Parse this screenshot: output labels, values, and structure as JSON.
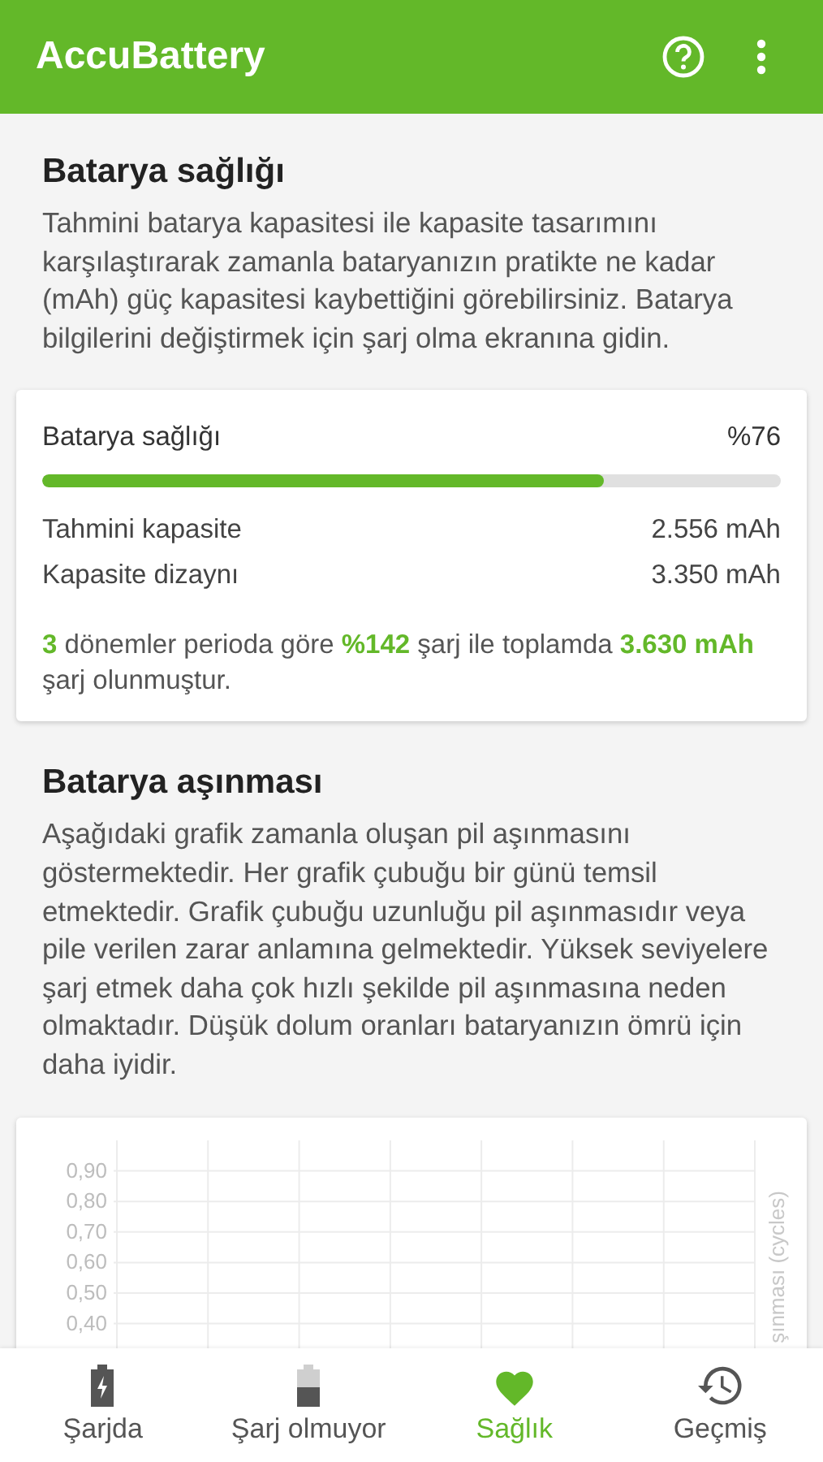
{
  "app_bar": {
    "title": "AccuBattery"
  },
  "health": {
    "title": "Batarya sağlığı",
    "description": "Tahmini batarya kapasitesi ile kapasite tasarımını karşılaştırarak zamanla bataryanızın pratikte ne kadar (mAh) güç kapasitesi kaybettiğini görebilirsiniz. Batarya bilgilerini değiştirmek için şarj olma ekranına gidin.",
    "card": {
      "label": "Batarya sağlığı",
      "value": "%76",
      "level": 0.76,
      "rows": [
        {
          "label": "Tahmini kapasite",
          "value": "2.556 mAh"
        },
        {
          "label": "Kapasite dizaynı",
          "value": "3.350 mAh"
        }
      ],
      "summary": "**3** dönemler perioda göre **%142** şarj ile toplamda **3.630 mAh** şarj olunmuştur."
    }
  },
  "wear": {
    "title": "Batarya aşınması",
    "description": "Aşağıdaki grafik zamanla oluşan pil aşınmasını göstermektedir. Her grafik çubuğu bir günü temsil etmektedir. Grafik çubuğu uzunluğu pil aşınmasıdır veya pile verilen zarar anlamına gelmektedir. Yüksek seviyelere şarj etmek daha çok hızlı şekilde pil aşınmasına neden olmaktadır. Düşük dolum oranları bataryanızın ömrü için daha iyidir.",
    "chart_data": {
      "type": "bar",
      "categories": [
        null,
        null,
        null,
        null,
        null,
        null,
        null
      ],
      "values": [
        null,
        null,
        null,
        null,
        null,
        null,
        null
      ],
      "grid": true,
      "ylim": [
        0,
        1
      ],
      "ylabel": "şınması (cycles)",
      "yticks": [
        {
          "value": 0.9,
          "label": "0,90"
        },
        {
          "value": 0.8,
          "label": "0,80"
        },
        {
          "value": 0.7,
          "label": "0,70"
        },
        {
          "value": 0.6,
          "label": "0,60"
        },
        {
          "value": 0.5,
          "label": "0,50"
        },
        {
          "value": 0.4,
          "label": "0,40"
        }
      ]
    }
  },
  "bottom_nav": [
    {
      "kind": "charging",
      "label": "Şarjda",
      "selected": false
    },
    {
      "kind": "discharging",
      "label": "Şarj olmuyor",
      "selected": false
    },
    {
      "kind": "health",
      "label": "Sağlık",
      "selected": true
    },
    {
      "kind": "history",
      "label": "Geçmiş",
      "selected": false
    }
  ]
}
